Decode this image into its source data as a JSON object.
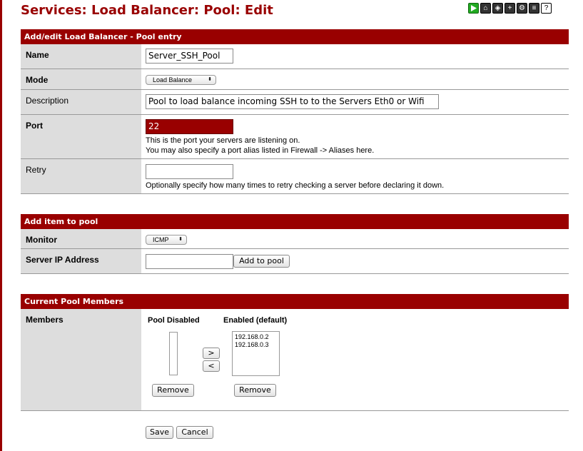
{
  "page": {
    "title": "Services: Load Balancer: Pool: Edit"
  },
  "toolbar": {
    "icons": [
      "play-icon",
      "home-icon",
      "network-icon",
      "add-icon",
      "settings-icon",
      "log-icon",
      "help-icon"
    ]
  },
  "section1": {
    "header": "Add/edit Load Balancer - Pool entry",
    "name_label": "Name",
    "name_value": "Server_SSH_Pool",
    "mode_label": "Mode",
    "mode_value": "Load Balance",
    "description_label": "Description",
    "description_value": "Pool to load balance incoming SSH to to the Servers Eth0 or Wifi",
    "port_label": "Port",
    "port_value": "22",
    "port_help1": "This is the port your servers are listening on.",
    "port_help2": "You may also specify a port alias listed in Firewall -> Aliases here.",
    "retry_label": "Retry",
    "retry_value": "",
    "retry_help": "Optionally specify how many times to retry checking a server before declaring it down."
  },
  "section2": {
    "header": "Add item to pool",
    "monitor_label": "Monitor",
    "monitor_value": "ICMP",
    "server_ip_label": "Server IP Address",
    "server_ip_value": "",
    "add_button": "Add to pool"
  },
  "section3": {
    "header": "Current Pool Members",
    "members_label": "Members",
    "disabled_header": "Pool Disabled",
    "enabled_header": "Enabled (default)",
    "disabled_items": [],
    "enabled_items": [
      "192.168.0.2",
      "192.168.0.3"
    ],
    "move_right": ">",
    "move_left": "<",
    "remove_label": "Remove"
  },
  "footer": {
    "save": "Save",
    "cancel": "Cancel"
  }
}
